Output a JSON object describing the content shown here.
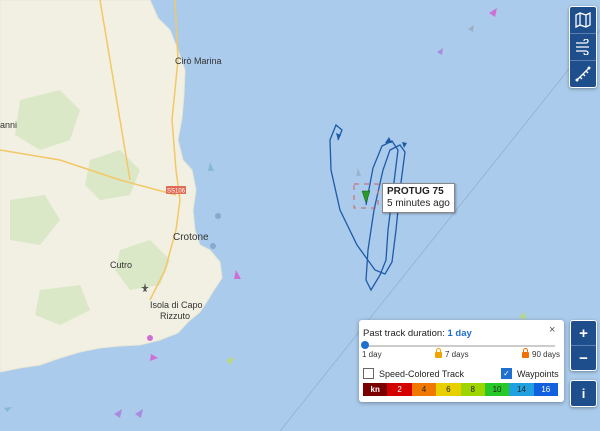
{
  "map": {
    "places": [
      "Cirò Marina",
      "Crotone",
      "Cutro",
      "Isola di Capo\nRizzuto",
      "anni"
    ],
    "road_label": "SS106"
  },
  "vessel": {
    "name": "PROTUG 75",
    "time_ago": "5 minutes ago"
  },
  "controls": {
    "map_icon": "map-icon",
    "wind_icon": "wind-icon",
    "measure_icon": "measure-icon",
    "zoom_in": "+",
    "zoom_out": "−",
    "info": "i"
  },
  "track_panel": {
    "title_prefix": "Past track duration:",
    "title_value": "1 day",
    "close": "×",
    "ticks": [
      "1 day",
      "7 days",
      "90 days"
    ],
    "speed_colored_label": "Speed-Colored Track",
    "waypoints_label": "Waypoints",
    "speed_colored_checked": false,
    "waypoints_checked": true,
    "speed_unit": "kn",
    "speed_ticks": [
      "2",
      "4",
      "6",
      "8",
      "10",
      "14",
      "16"
    ],
    "speed_colors": [
      "#7a0000",
      "#d40000",
      "#f07800",
      "#e8d000",
      "#9ed400",
      "#28c828",
      "#1fa0e0",
      "#1060e0"
    ]
  }
}
